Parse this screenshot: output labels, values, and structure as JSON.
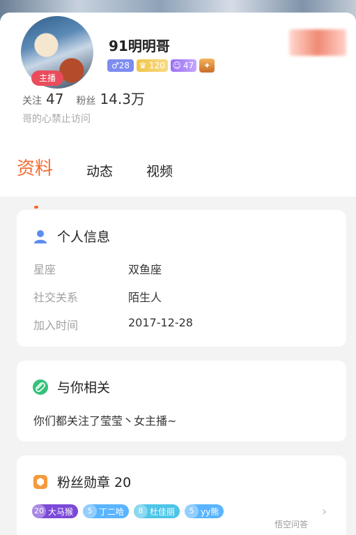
{
  "profile": {
    "name": "91明明哥",
    "role_badge": "主播",
    "gender_age": "♂28",
    "wealth_level": "120",
    "fan_level": "47",
    "follow_label": "关注",
    "follow_count": "47",
    "fans_label": "粉丝",
    "fans_count": "14.3万",
    "bio": "哥的心禁止访问"
  },
  "tabs": [
    {
      "label": "资料",
      "active": true
    },
    {
      "label": "动态",
      "active": false
    },
    {
      "label": "视频",
      "active": false
    }
  ],
  "personal_info": {
    "title": "个人信息",
    "rows": [
      {
        "key": "星座",
        "value": "双鱼座"
      },
      {
        "key": "社交关系",
        "value": "陌生人"
      },
      {
        "key": "加入时间",
        "value": "2017-12-28"
      }
    ]
  },
  "related": {
    "title": "与你相关",
    "text": "你们都关注了莹莹丶女主播~"
  },
  "fan_medals": {
    "title": "粉丝勋章 20",
    "medals": [
      {
        "level": "20",
        "name": "大马猴",
        "color": "purple"
      },
      {
        "level": "5",
        "name": "丁二哈",
        "color": "blue"
      },
      {
        "level": "8",
        "name": "杜佳丽",
        "color": "cyan"
      },
      {
        "level": "5",
        "name": "yy熊",
        "color": "blue"
      }
    ]
  },
  "watermark": "悟空问答",
  "colors": {
    "accent": "#f26a2e",
    "anchor_badge": "#ea4c5c",
    "info_icon": "#5b8def",
    "link_icon": "#33c27a",
    "medal_icon": "#f59a3c"
  }
}
